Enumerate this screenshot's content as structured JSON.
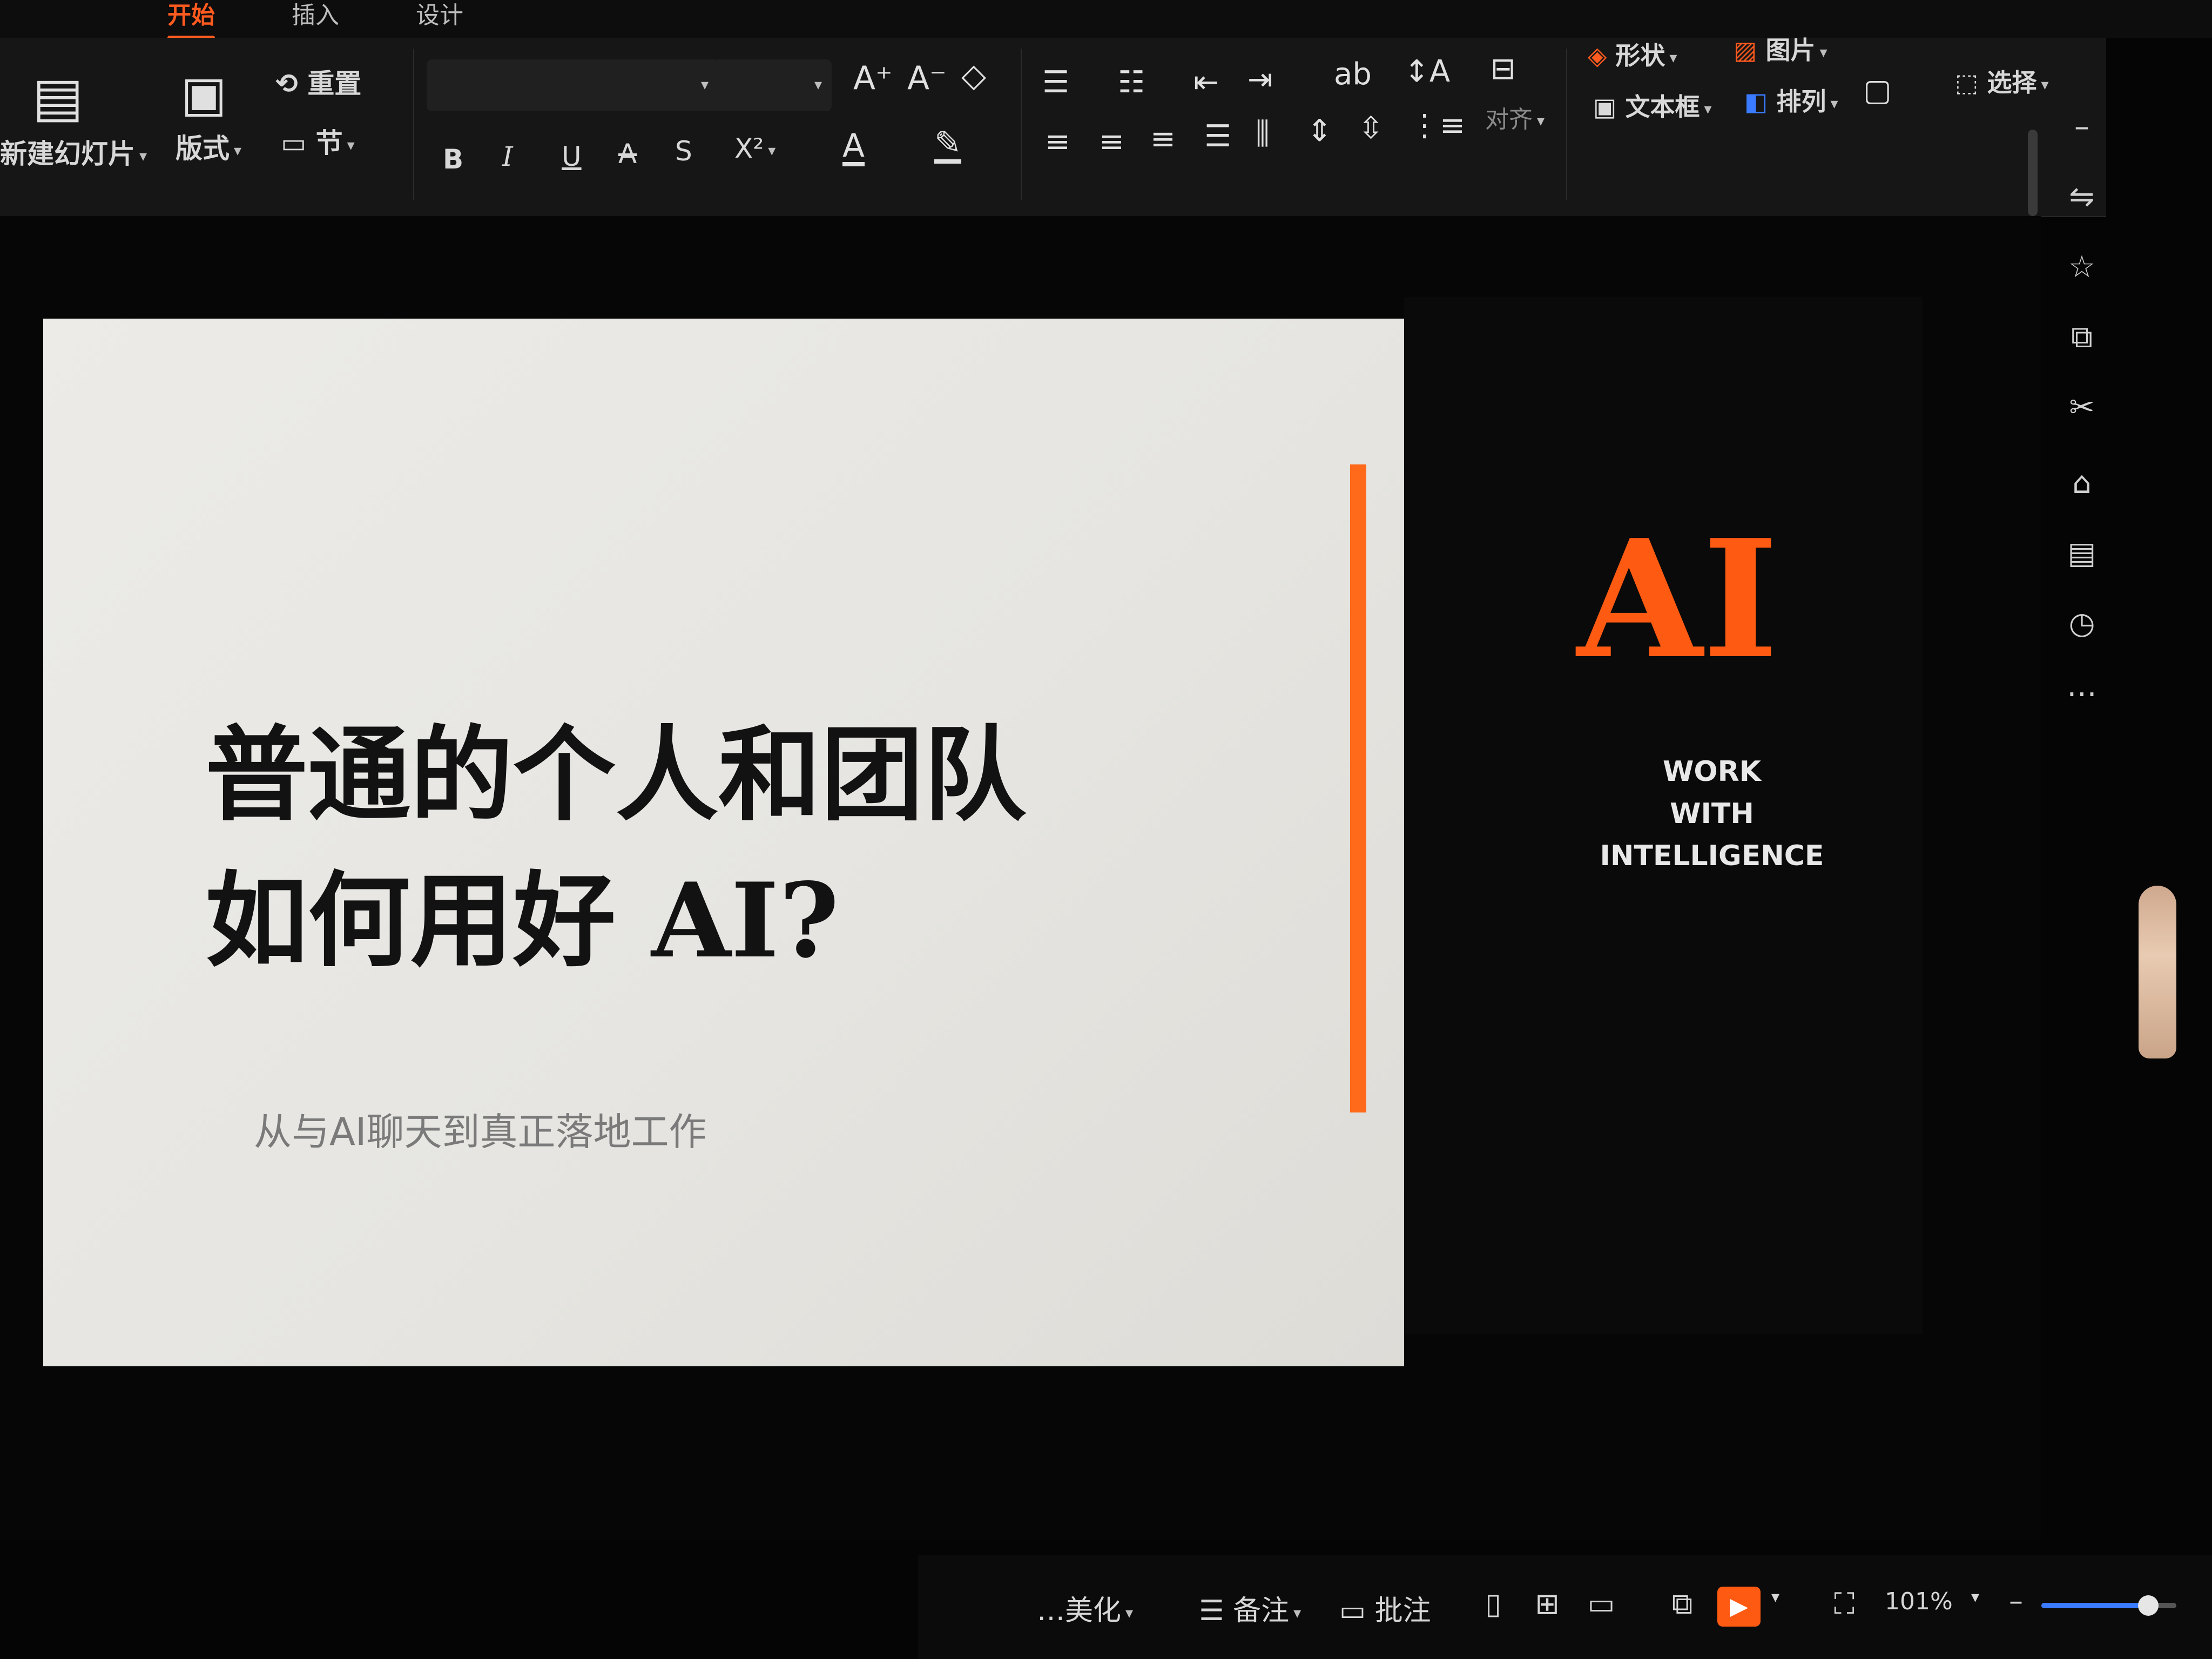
{
  "tabs": [
    {
      "label": "开始",
      "active": true
    },
    {
      "label": "插入",
      "active": false
    },
    {
      "label": "设计",
      "active": false
    }
  ],
  "ribbon": {
    "new_slide": "新建幻灯片",
    "layout": "版式",
    "reset": "重置",
    "section": "节",
    "font_buttons": [
      "B",
      "I",
      "U",
      "A",
      "S",
      "X²"
    ],
    "align_label": "对齐",
    "shape": "形状",
    "picture": "图片",
    "textbox": "文本框",
    "arrange": "排列",
    "select": "选择"
  },
  "slide": {
    "title_line1": "普通的个人和团队",
    "title_line2": "如何用好 AI?",
    "subtitle": "从与AI聊天到真正落地工作",
    "ai_word": "AI",
    "tagline": [
      "WORK",
      "WITH",
      "INTELLIGENCE"
    ],
    "accent_color": "#ff6a1a"
  },
  "side_rail_icons": [
    "collapse-icon",
    "style-icon",
    "star-icon",
    "shapes-icon",
    "tools-icon",
    "dots-icon"
  ],
  "statusbar": {
    "beautify": "…美化",
    "notes": "备注",
    "comments": "批注",
    "zoom": "101%",
    "zoom_fraction": 0.79
  }
}
